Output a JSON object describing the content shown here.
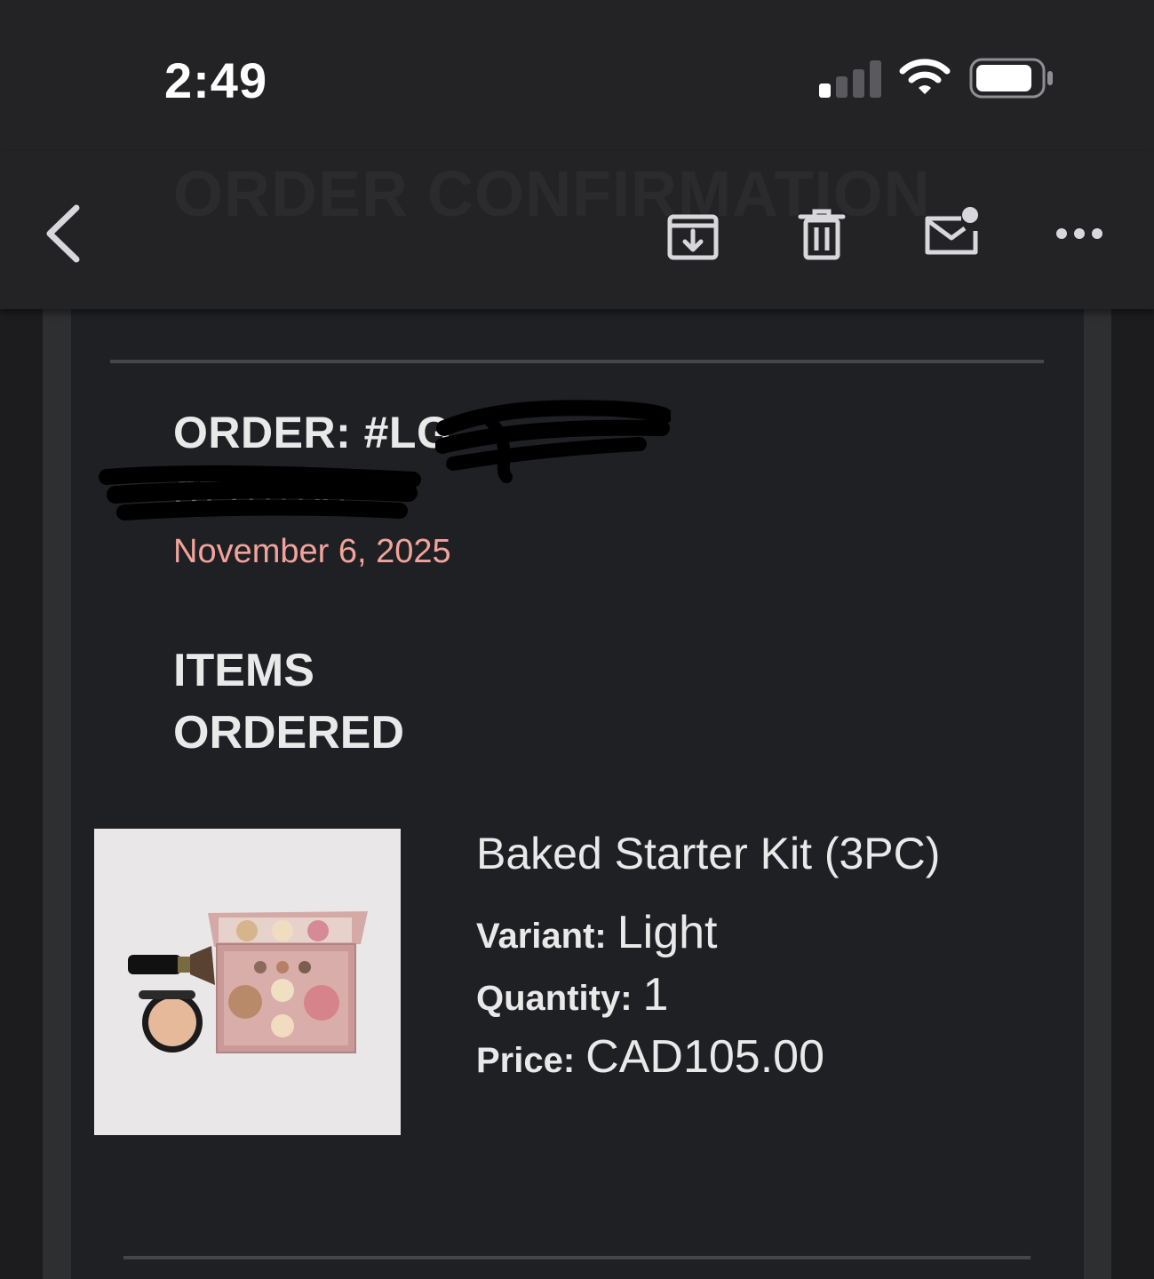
{
  "status_bar": {
    "time": "2:49"
  },
  "toolbar": {
    "ghost_title": "ORDER CONFIRMATION",
    "buttons": [
      "back-icon",
      "archive-icon",
      "trash-icon",
      "mark-unread-icon",
      "more-icon"
    ]
  },
  "order": {
    "label": "ORDER: #LG",
    "number_line2": "6770700",
    "date": "November 6, 2025"
  },
  "items_heading": [
    "ITEMS",
    "ORDERED"
  ],
  "item": {
    "name": "Baked Starter Kit (3PC)",
    "variant_label": "Variant:",
    "variant_value": "Light",
    "quantity_label": "Quantity:",
    "quantity_value": "1",
    "price_label": "Price:",
    "price_value": "CAD105.00"
  },
  "colors": {
    "background": "#1c1c1e",
    "toolbar": "#232325",
    "card": "#1f2023",
    "date_accent": "#f2a39b"
  }
}
